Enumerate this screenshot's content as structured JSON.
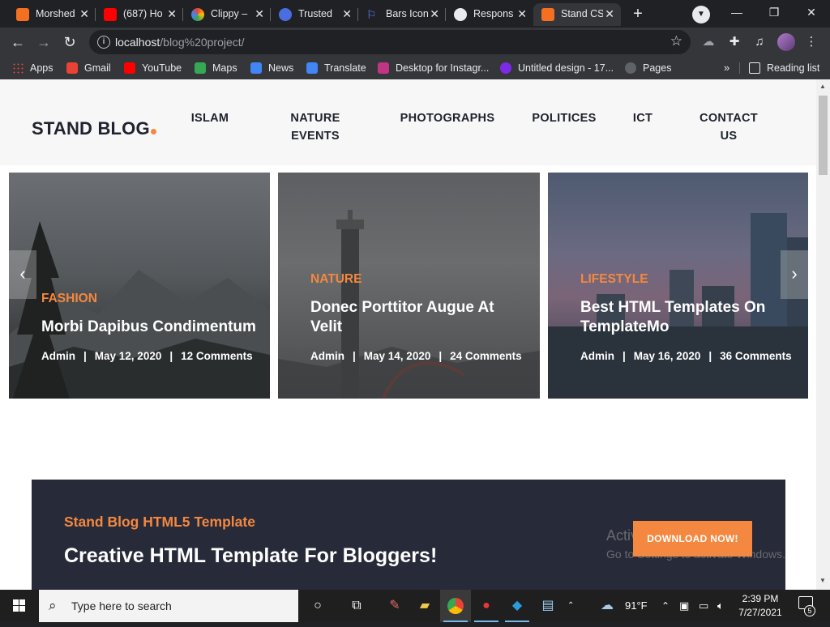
{
  "browser": {
    "tabs": [
      {
        "title": "Morshed",
        "favicon_color": "#f37021"
      },
      {
        "title": "(687) Ho",
        "favicon_color": "#ff0000"
      },
      {
        "title": "Clippy –",
        "favicon_color": "#ffffff"
      },
      {
        "title": "Trusted",
        "favicon_color": "#4a6ee0"
      },
      {
        "title": "Bars Icon",
        "favicon_color": "#5b8cff"
      },
      {
        "title": "Respons",
        "favicon_color": "#e8eaed"
      },
      {
        "title": "Stand CS",
        "favicon_color": "#f37021",
        "active": true
      }
    ],
    "new_tab_label": "+",
    "window": {
      "minimize": "—",
      "maximize": "❐",
      "close": "✕"
    },
    "url_host": "localhost",
    "url_path": "/blog%20project/",
    "bookmarks": [
      {
        "label": "Apps",
        "color": "#4285f4"
      },
      {
        "label": "Gmail",
        "color": "#ea4335"
      },
      {
        "label": "YouTube",
        "color": "#ff0000"
      },
      {
        "label": "Maps",
        "color": "#34a853"
      },
      {
        "label": "News",
        "color": "#4285f4"
      },
      {
        "label": "Translate",
        "color": "#4285f4"
      },
      {
        "label": "Desktop for Instagr...",
        "color": "#c13584"
      },
      {
        "label": "Untitled design - 17...",
        "color": "#7d2ae8"
      },
      {
        "label": "Pages",
        "color": "#5f6368"
      }
    ],
    "reading_list": "Reading list"
  },
  "site": {
    "logo": "STAND BLOG",
    "nav": [
      {
        "label": "ISLAM"
      },
      {
        "label": "NATURE",
        "label2": "EVENTS"
      },
      {
        "label": "PHOTOGRAPHS"
      },
      {
        "label": "POLITICES"
      },
      {
        "label": "ICT"
      },
      {
        "label": "CONTACT",
        "label2": "US"
      }
    ],
    "slides": [
      {
        "category": "FASHION",
        "title": "Morbi Dapibus Condimentum",
        "title2": "",
        "author": "Admin",
        "date": "May 12, 2020",
        "comments": "12 Comments"
      },
      {
        "category": "NATURE",
        "title": "Donec Porttitor Augue At",
        "title2": "Velit",
        "author": "Admin",
        "date": "May 14, 2020",
        "comments": "24 Comments"
      },
      {
        "category": "LIFESTYLE",
        "title": "Best HTML Templates On",
        "title2": "TemplateMo",
        "author": "Admin",
        "date": "May 16, 2020",
        "comments": "36 Comments"
      }
    ],
    "slider_prev": "‹",
    "slider_next": "›",
    "banner": {
      "subtitle": "Stand Blog HTML5 Template",
      "title": "Creative HTML Template For Bloggers!",
      "button": "DOWNLOAD NOW!"
    },
    "accent_color": "#f48840"
  },
  "watermark": {
    "line1": "Activate Windows",
    "line2": "Go to Settings to activate Windows."
  },
  "taskbar": {
    "search_placeholder": "Type here to search",
    "weather": "91°F",
    "time": "2:39 PM",
    "date": "7/27/2021",
    "notifications": "5"
  }
}
